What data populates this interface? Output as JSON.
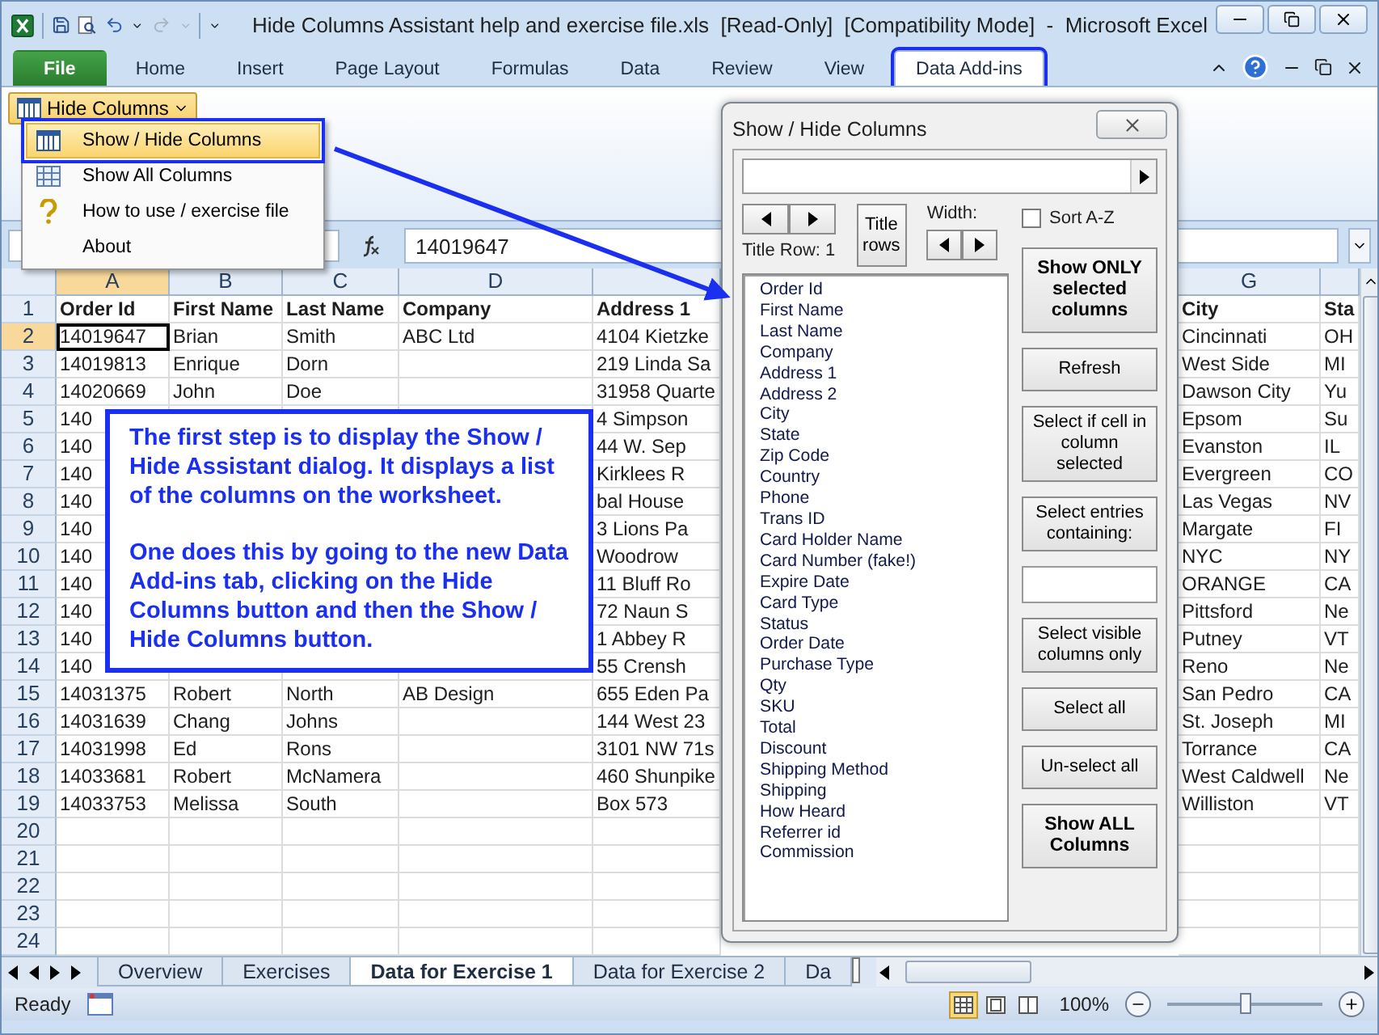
{
  "window": {
    "title": "Hide Columns Assistant help and exercise file.xls  [Read-Only]  [Compatibility Mode]  -  Microsoft Excel"
  },
  "ribbon_tabs": [
    {
      "label": "File",
      "kind": "file",
      "selected": false,
      "outlined": false
    },
    {
      "label": "Home",
      "kind": "tab",
      "selected": false,
      "outlined": false
    },
    {
      "label": "Insert",
      "kind": "tab",
      "selected": false,
      "outlined": false
    },
    {
      "label": "Page Layout",
      "kind": "tab",
      "selected": false,
      "outlined": false
    },
    {
      "label": "Formulas",
      "kind": "tab",
      "selected": false,
      "outlined": false
    },
    {
      "label": "Data",
      "kind": "tab",
      "selected": false,
      "outlined": false
    },
    {
      "label": "Review",
      "kind": "tab",
      "selected": false,
      "outlined": false
    },
    {
      "label": "View",
      "kind": "tab",
      "selected": false,
      "outlined": false
    },
    {
      "label": "Data Add-ins",
      "kind": "tab",
      "selected": true,
      "outlined": true
    }
  ],
  "ribbon": {
    "button": {
      "label": "Hide Columns",
      "open": true
    }
  },
  "menu": {
    "items": [
      {
        "label": "Show / Hide Columns",
        "selected": true,
        "outlined": true
      },
      {
        "label": "Show All Columns",
        "selected": false,
        "outlined": false
      },
      {
        "label": "How to use / exercise file",
        "selected": false,
        "outlined": false
      },
      {
        "label": "About",
        "selected": false,
        "outlined": false
      }
    ]
  },
  "formula_bar": {
    "value": "14019647"
  },
  "sheet": {
    "columns": [
      {
        "label": "A",
        "selected": true
      },
      {
        "label": "B",
        "selected": false
      },
      {
        "label": "C",
        "selected": false
      },
      {
        "label": "D",
        "selected": false
      },
      {
        "selected": false
      },
      {
        "label": "G",
        "selected": false
      },
      {
        "selected": false
      }
    ],
    "rows": [
      {
        "number": "1",
        "kind": "header",
        "selected": false,
        "cells": [
          "Order Id",
          "First Name",
          "Last Name",
          "Company",
          "Address 1",
          "City",
          "Sta"
        ]
      },
      {
        "number": "2",
        "kind": "data",
        "selected": true,
        "cells": [
          "14019647",
          "Brian",
          "Smith",
          "ABC Ltd",
          "4104 Kietzke",
          "Cincinnati",
          "OH"
        ]
      },
      {
        "number": "3",
        "kind": "data",
        "selected": false,
        "cells": [
          "14019813",
          "Enrique",
          "Dorn",
          null,
          "219 Linda Sa",
          "West Side",
          "MI"
        ]
      },
      {
        "number": "4",
        "kind": "data",
        "selected": false,
        "cells": [
          "14020669",
          "John",
          "Doe",
          null,
          "31958 Quarte",
          "Dawson City",
          "Yu"
        ]
      },
      {
        "number": "5",
        "kind": "data",
        "selected": false,
        "cells": [
          "140",
          null,
          null,
          null,
          "4 Simpson",
          "Epsom",
          "Su"
        ]
      },
      {
        "number": "6",
        "kind": "data",
        "selected": false,
        "cells": [
          "140",
          null,
          null,
          null,
          "44 W. Sep",
          "Evanston",
          "IL"
        ]
      },
      {
        "number": "7",
        "kind": "data",
        "selected": false,
        "cells": [
          "140",
          null,
          null,
          null,
          "Kirklees R",
          "Evergreen",
          "CO"
        ]
      },
      {
        "number": "8",
        "kind": "data",
        "selected": false,
        "cells": [
          "140",
          null,
          null,
          null,
          "bal House",
          "Las Vegas",
          "NV"
        ]
      },
      {
        "number": "9",
        "kind": "data",
        "selected": false,
        "cells": [
          "140",
          null,
          null,
          null,
          "3 Lions Pa",
          "Margate",
          "FI"
        ]
      },
      {
        "number": "10",
        "kind": "data",
        "selected": false,
        "cells": [
          "140",
          null,
          null,
          null,
          "Woodrow",
          "NYC",
          "NY"
        ]
      },
      {
        "number": "11",
        "kind": "data",
        "selected": false,
        "cells": [
          "140",
          null,
          null,
          null,
          "11 Bluff Ro",
          "ORANGE",
          "CA"
        ]
      },
      {
        "number": "12",
        "kind": "data",
        "selected": false,
        "cells": [
          "140",
          null,
          null,
          null,
          "72 Naun S",
          "Pittsford",
          "Ne"
        ]
      },
      {
        "number": "13",
        "kind": "data",
        "selected": false,
        "cells": [
          "140",
          null,
          null,
          null,
          "1 Abbey R",
          "Putney",
          "VT"
        ]
      },
      {
        "number": "14",
        "kind": "data",
        "selected": false,
        "cells": [
          "140",
          null,
          null,
          null,
          "55 Crensh",
          "Reno",
          "Ne"
        ]
      },
      {
        "number": "15",
        "kind": "data",
        "selected": false,
        "cells": [
          "14031375",
          "Robert",
          "North",
          "AB Design",
          "655 Eden Pa",
          "San Pedro",
          "CA"
        ]
      },
      {
        "number": "16",
        "kind": "data",
        "selected": false,
        "cells": [
          "14031639",
          "Chang",
          "Johns",
          null,
          "144 West 23",
          "St. Joseph",
          "MI"
        ]
      },
      {
        "number": "17",
        "kind": "data",
        "selected": false,
        "cells": [
          "14031998",
          "Ed",
          "Rons",
          null,
          "3101 NW 71s",
          "Torrance",
          "CA"
        ]
      },
      {
        "number": "18",
        "kind": "data",
        "selected": false,
        "cells": [
          "14033681",
          "Robert",
          "McNamera",
          null,
          "460 Shunpike",
          "West Caldwell",
          "Ne"
        ]
      },
      {
        "number": "19",
        "kind": "data",
        "selected": false,
        "cells": [
          "14033753",
          "Melissa",
          "South",
          null,
          "Box 573",
          "Williston",
          "VT"
        ]
      },
      {
        "number": "20",
        "kind": "data",
        "selected": false,
        "cells": []
      },
      {
        "number": "21",
        "kind": "data",
        "selected": false,
        "cells": []
      },
      {
        "number": "22",
        "kind": "data",
        "selected": false,
        "cells": []
      },
      {
        "number": "23",
        "kind": "data",
        "selected": false,
        "cells": []
      },
      {
        "number": "24",
        "kind": "data",
        "selected": false,
        "cells": []
      }
    ]
  },
  "callout": {
    "paragraphs": [
      "The first step is to display the Show / Hide Assistant dialog.  It displays a list of the columns on the worksheet.",
      "One does this by going to the new Data Add-ins tab, clicking on the Hide Columns button and then the Show / Hide Columns button."
    ]
  },
  "dialog": {
    "title": "Show / Hide Columns",
    "title_rows_button": "Title rows",
    "width_label": "Width:",
    "title_row_label": "Title Row: 1",
    "sort": {
      "label": "Sort A-Z",
      "checked": false
    },
    "columns": [
      "Order Id",
      "First Name",
      "Last Name",
      "Company",
      "Address 1",
      "Address 2",
      "City",
      "State",
      "Zip Code",
      "Country",
      "Phone",
      "Trans ID",
      "Card Holder Name",
      "Card Number (fake!)",
      "Expire Date",
      "Card Type",
      "Status",
      "Order Date",
      "Purchase Type",
      "Qty",
      "SKU",
      "Total",
      "Discount",
      "Shipping Method",
      "Shipping",
      "How Heard",
      "Referrer id",
      "Commission"
    ],
    "buttons": [
      {
        "label": "Show ONLY selected columns",
        "kind": "bold"
      },
      {
        "label": "Refresh",
        "kind": "normal"
      },
      {
        "label": "Select if cell in column selected",
        "kind": "normal"
      },
      {
        "label": "Select entries containing:",
        "kind": "normal"
      },
      {
        "kind": "field"
      },
      {
        "label": "Select visible columns only",
        "kind": "normal"
      },
      {
        "label": "Select all",
        "kind": "normal"
      },
      {
        "label": "Un-select all",
        "kind": "normal"
      },
      {
        "label": "Show ALL Columns",
        "kind": "bold"
      }
    ]
  },
  "sheet_tabs": [
    {
      "label": "Overview",
      "selected": false
    },
    {
      "label": "Exercises",
      "selected": false
    },
    {
      "label": "Data for Exercise 1",
      "selected": true
    },
    {
      "label": "Data for Exercise 2",
      "selected": false
    },
    {
      "label": "Da",
      "selected": false
    }
  ],
  "status_bar": {
    "status": "Ready",
    "views": [
      {
        "selected": true
      },
      {
        "selected": false
      },
      {
        "selected": false
      }
    ],
    "zoom": "100%",
    "zoom_slider": {
      "level": 0.5
    }
  }
}
